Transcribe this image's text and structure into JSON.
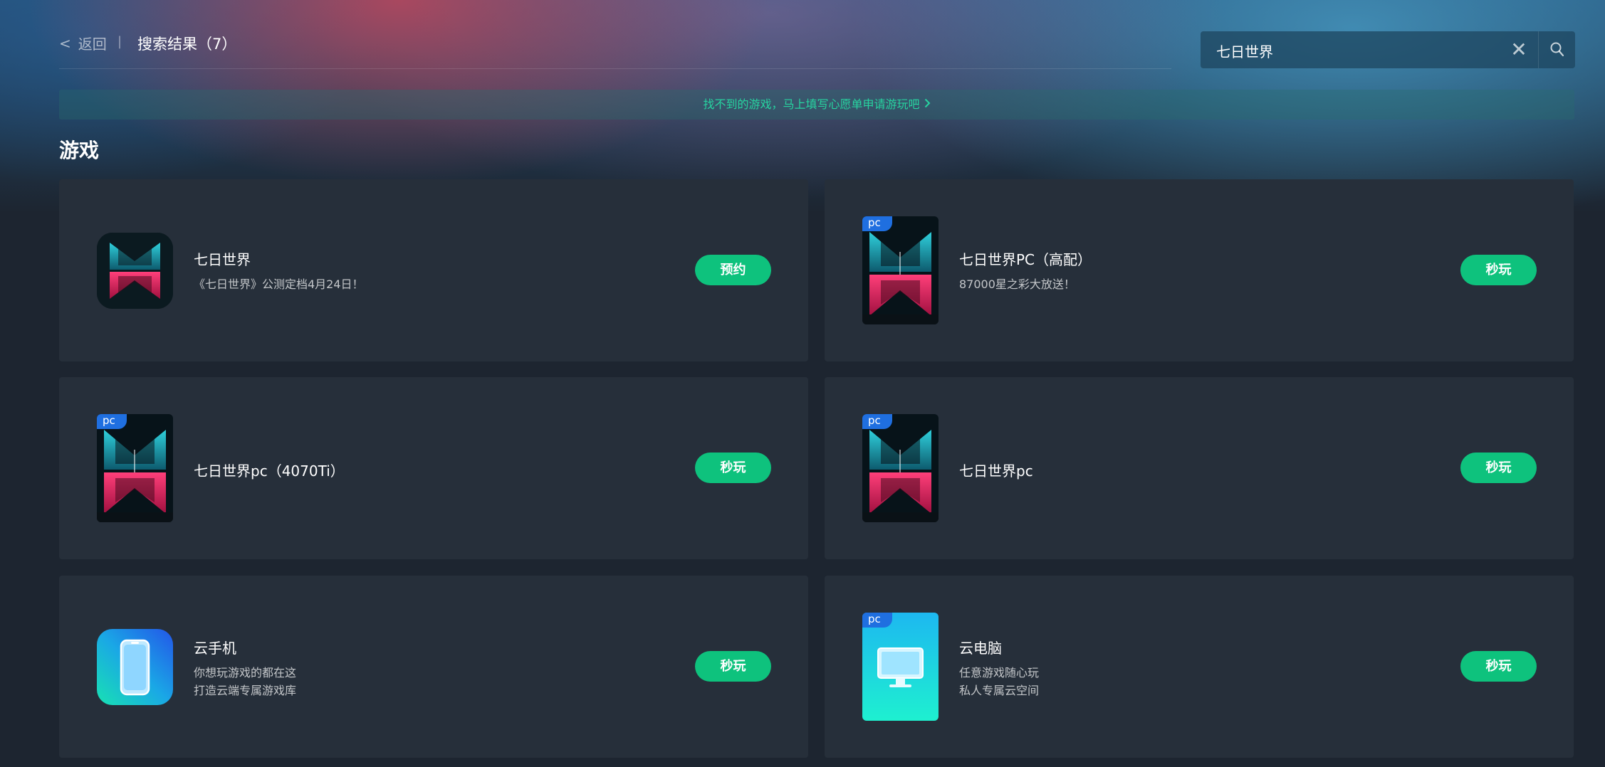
{
  "header": {
    "back_label": "返回",
    "back_chevron": "<",
    "separator": "|",
    "title": "搜索结果（7）"
  },
  "search": {
    "value": "七日世界",
    "clear_icon": "close-icon",
    "search_icon": "search-icon"
  },
  "notice": {
    "text": "找不到的游戏，马上填写心愿单申请游玩吧"
  },
  "section_title": "游戏",
  "colors": {
    "accent_green": "#0ec27d",
    "notice_text": "#27d4a0",
    "card_bg": "#262f3a",
    "pc_badge": "#1f6fe0"
  },
  "cards": [
    {
      "name": "七日世界",
      "desc1": "《七日世界》公测定档4月24日！",
      "desc2": "",
      "button": "预约",
      "badge": "",
      "icon": "seven-days-world-logo-icon"
    },
    {
      "name": "七日世界PC（高配）",
      "desc1": "87000星之彩大放送！",
      "desc2": "",
      "button": "秒玩",
      "badge": "pc",
      "icon": "seven-days-world-poster-icon"
    },
    {
      "name": "七日世界pc（4070Ti）",
      "desc1": "",
      "desc2": "",
      "button": "秒玩",
      "badge": "pc",
      "icon": "seven-days-world-poster-icon"
    },
    {
      "name": "七日世界pc",
      "desc1": "",
      "desc2": "",
      "button": "秒玩",
      "badge": "pc",
      "icon": "seven-days-world-poster-icon"
    },
    {
      "name": "云手机",
      "desc1": "你想玩游戏的都在这",
      "desc2": "打造云端专属游戏库",
      "button": "秒玩",
      "badge": "",
      "icon": "cloud-phone-icon"
    },
    {
      "name": "云电脑",
      "desc1": "任意游戏随心玩",
      "desc2": "私人专属云空间",
      "button": "秒玩",
      "badge": "pc",
      "icon": "cloud-pc-icon"
    }
  ]
}
